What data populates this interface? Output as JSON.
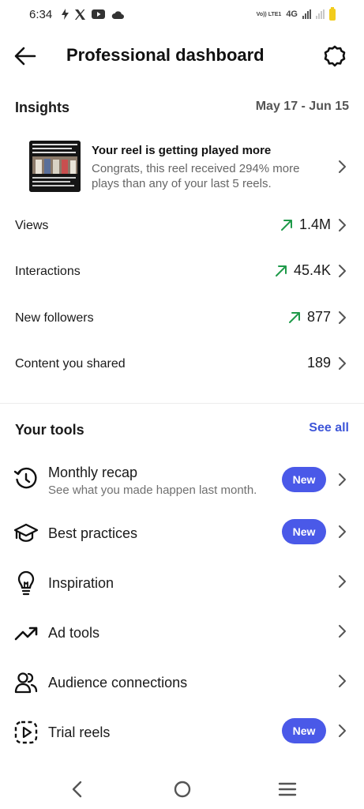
{
  "status_bar": {
    "time": "6:34",
    "left_icons": [
      "bolt-icon",
      "x-logo-icon",
      "youtube-icon",
      "cloud-icon"
    ],
    "volte_label": "Vo)) LTE1",
    "network_label": "4G",
    "battery_color": "#f2cc1c"
  },
  "header": {
    "title": "Professional dashboard",
    "back_icon": "arrow-left-icon",
    "settings_icon": "gear-icon"
  },
  "insights": {
    "title": "Insights",
    "date_range": "May 17 - Jun 15",
    "reel_card": {
      "title": "Your reel is getting played more",
      "body": "Congrats, this reel received 294% more plays than any of your last 5 reels."
    },
    "metrics": [
      {
        "label": "Views",
        "value": "1.4M",
        "trend": "up"
      },
      {
        "label": "Interactions",
        "value": "45.4K",
        "trend": "up"
      },
      {
        "label": "New followers",
        "value": "877",
        "trend": "up"
      },
      {
        "label": "Content you shared",
        "value": "189",
        "trend": "none"
      }
    ],
    "trend_color": "#1f9a4a"
  },
  "tools": {
    "title": "Your tools",
    "see_all": "See all",
    "badge_color": "#4a59e8",
    "items": [
      {
        "label": "Monthly recap",
        "subtitle": "See what you made happen last month.",
        "badge": "New",
        "icon": "history-clock-icon"
      },
      {
        "label": "Best practices",
        "badge": "New",
        "icon": "graduation-cap-icon"
      },
      {
        "label": "Inspiration",
        "icon": "lightbulb-icon"
      },
      {
        "label": "Ad tools",
        "icon": "trending-up-icon"
      },
      {
        "label": "Audience connections",
        "icon": "people-icon"
      },
      {
        "label": "Trial reels",
        "badge": "New",
        "icon": "reel-play-icon"
      }
    ]
  },
  "nav_bar": {
    "icons": [
      "back-triangle-icon",
      "home-circle-icon",
      "menu-lines-icon"
    ]
  }
}
